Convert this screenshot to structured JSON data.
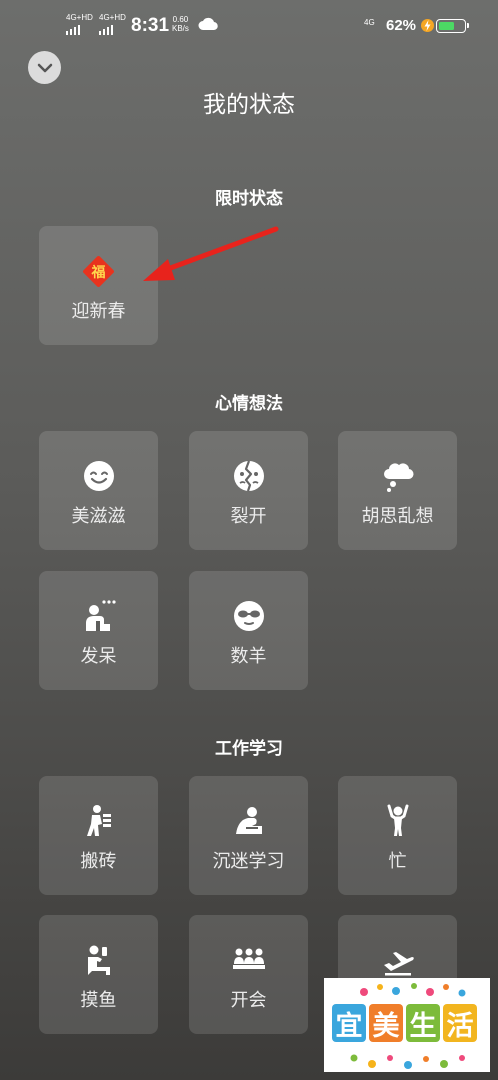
{
  "status_bar": {
    "sim1": "4G+HD",
    "sim2": "4G+HD",
    "time": "8:31",
    "speed_value": "0.60",
    "speed_unit": "KB/s",
    "network": "4G",
    "battery": "62%",
    "battery_level": 0.62,
    "battery_color": "#4cd964"
  },
  "header": {
    "back_icon": "chevron-down-icon",
    "title": "我的状态"
  },
  "sections": {
    "limited": {
      "title": "限时状态",
      "items": [
        {
          "label": "迎新春",
          "icon": "fu-icon",
          "icon_text": "福"
        }
      ]
    },
    "mood": {
      "title": "心情想法",
      "items": [
        {
          "label": "美滋滋",
          "icon": "smile-face-icon"
        },
        {
          "label": "裂开",
          "icon": "cracked-face-icon"
        },
        {
          "label": "胡思乱想",
          "icon": "thought-bubble-icon"
        },
        {
          "label": "发呆",
          "icon": "daze-person-icon"
        },
        {
          "label": "数羊",
          "icon": "sleep-mask-icon"
        }
      ]
    },
    "work": {
      "title": "工作学习",
      "items": [
        {
          "label": "搬砖",
          "icon": "carry-bricks-icon"
        },
        {
          "label": "沉迷学习",
          "icon": "study-icon"
        },
        {
          "label": "忙",
          "icon": "busy-person-icon"
        },
        {
          "label": "摸鱼",
          "icon": "slack-off-icon"
        },
        {
          "label": "开会",
          "icon": "meeting-icon"
        },
        {
          "label": "",
          "icon": "airplane-icon"
        }
      ]
    }
  },
  "annotation": {
    "arrow_color": "#e8231c",
    "points_to": "迎新春"
  },
  "watermark": {
    "chars": [
      "宜",
      "美",
      "生",
      "活"
    ],
    "colors": [
      "#3aa6dd",
      "#f07e2a",
      "#7dbb3b",
      "#f2b51f"
    ]
  }
}
